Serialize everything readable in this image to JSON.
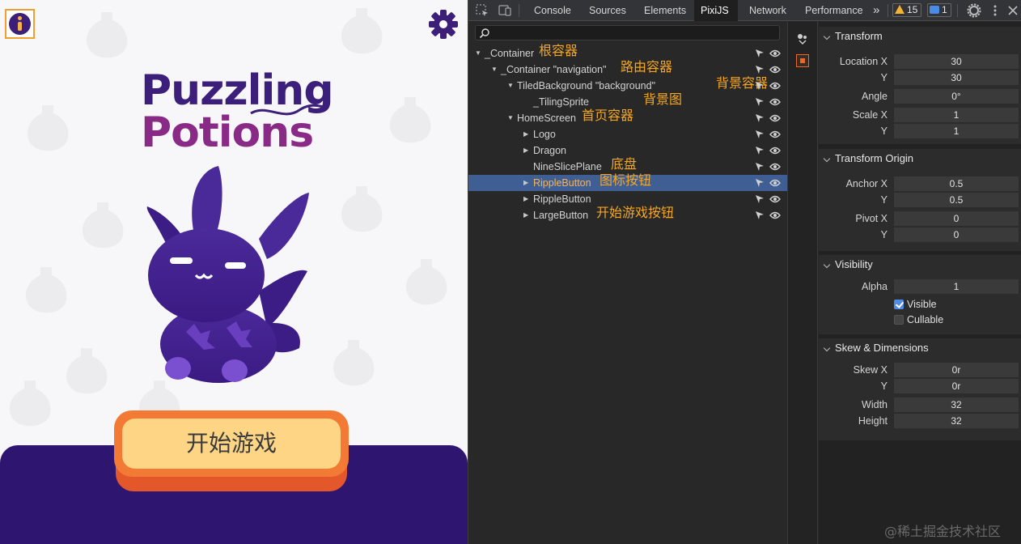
{
  "game": {
    "logo": {
      "line1": "Puzzling",
      "line2": "Potions"
    },
    "start_button_label": "开始游戏",
    "info_button_icon": "info-icon",
    "settings_button_icon": "gear-icon"
  },
  "devtools": {
    "tabs": [
      "Console",
      "Sources",
      "Elements",
      "PixiJS",
      "Network",
      "Performance"
    ],
    "active_tab": "PixiJS",
    "more_tabs": "»",
    "warnings_count": "15",
    "messages_count": "1",
    "search": {
      "value": "",
      "placeholder": ""
    }
  },
  "tree": [
    {
      "name": "_Container",
      "note": "根容器",
      "expanded": true,
      "indent": 0
    },
    {
      "name": "_Container \"navigation\"",
      "note": "路由容器",
      "expanded": true,
      "indent": 1
    },
    {
      "name": "TiledBackground \"background\"",
      "note": "背景容器",
      "expanded": true,
      "indent": 2
    },
    {
      "name": "_TilingSprite",
      "note": "背景图",
      "expanded": null,
      "indent": 3
    },
    {
      "name": "HomeScreen",
      "note": "首页容器",
      "expanded": true,
      "indent": 2
    },
    {
      "name": "Logo",
      "note": "",
      "expanded": false,
      "indent": 3
    },
    {
      "name": "Dragon",
      "note": "",
      "expanded": false,
      "indent": 3
    },
    {
      "name": "NineSlicePlane",
      "note": "底盘",
      "expanded": null,
      "indent": 3
    },
    {
      "name": "RippleButton",
      "note": "图标按钮",
      "expanded": false,
      "indent": 3,
      "selected": true
    },
    {
      "name": "RippleButton",
      "note": "",
      "expanded": false,
      "indent": 3
    },
    {
      "name": "LargeButton",
      "note": "开始游戏按钮",
      "expanded": false,
      "indent": 3
    }
  ],
  "properties": {
    "transform": {
      "title": "Transform",
      "location_label": "Location X",
      "location_x": "30",
      "y_label": "Y",
      "location_y": "30",
      "angle_label": "Angle",
      "angle": "0°",
      "scale_label": "Scale X",
      "scale_x": "1",
      "scale_y": "1"
    },
    "transform_origin": {
      "title": "Transform Origin",
      "anchor_label": "Anchor X",
      "anchor_x": "0.5",
      "anchor_y": "0.5",
      "pivot_label": "Pivot X",
      "pivot_x": "0",
      "pivot_y": "0"
    },
    "visibility": {
      "title": "Visibility",
      "alpha_label": "Alpha",
      "alpha": "1",
      "visible_label": "Visible",
      "visible": true,
      "cullable_label": "Cullable",
      "cullable": false
    },
    "skew": {
      "title": "Skew & Dimensions",
      "skew_label": "Skew X",
      "skew_x": "0r",
      "skew_y": "0r",
      "width_label": "Width",
      "width": "32",
      "height_label": "Height",
      "height": "32"
    }
  },
  "watermark": "@稀土掘金技术社区",
  "colors": {
    "accent_orange": "#f5a623",
    "selected_row": "#3f5f94",
    "game_purple": "#2e1570"
  }
}
